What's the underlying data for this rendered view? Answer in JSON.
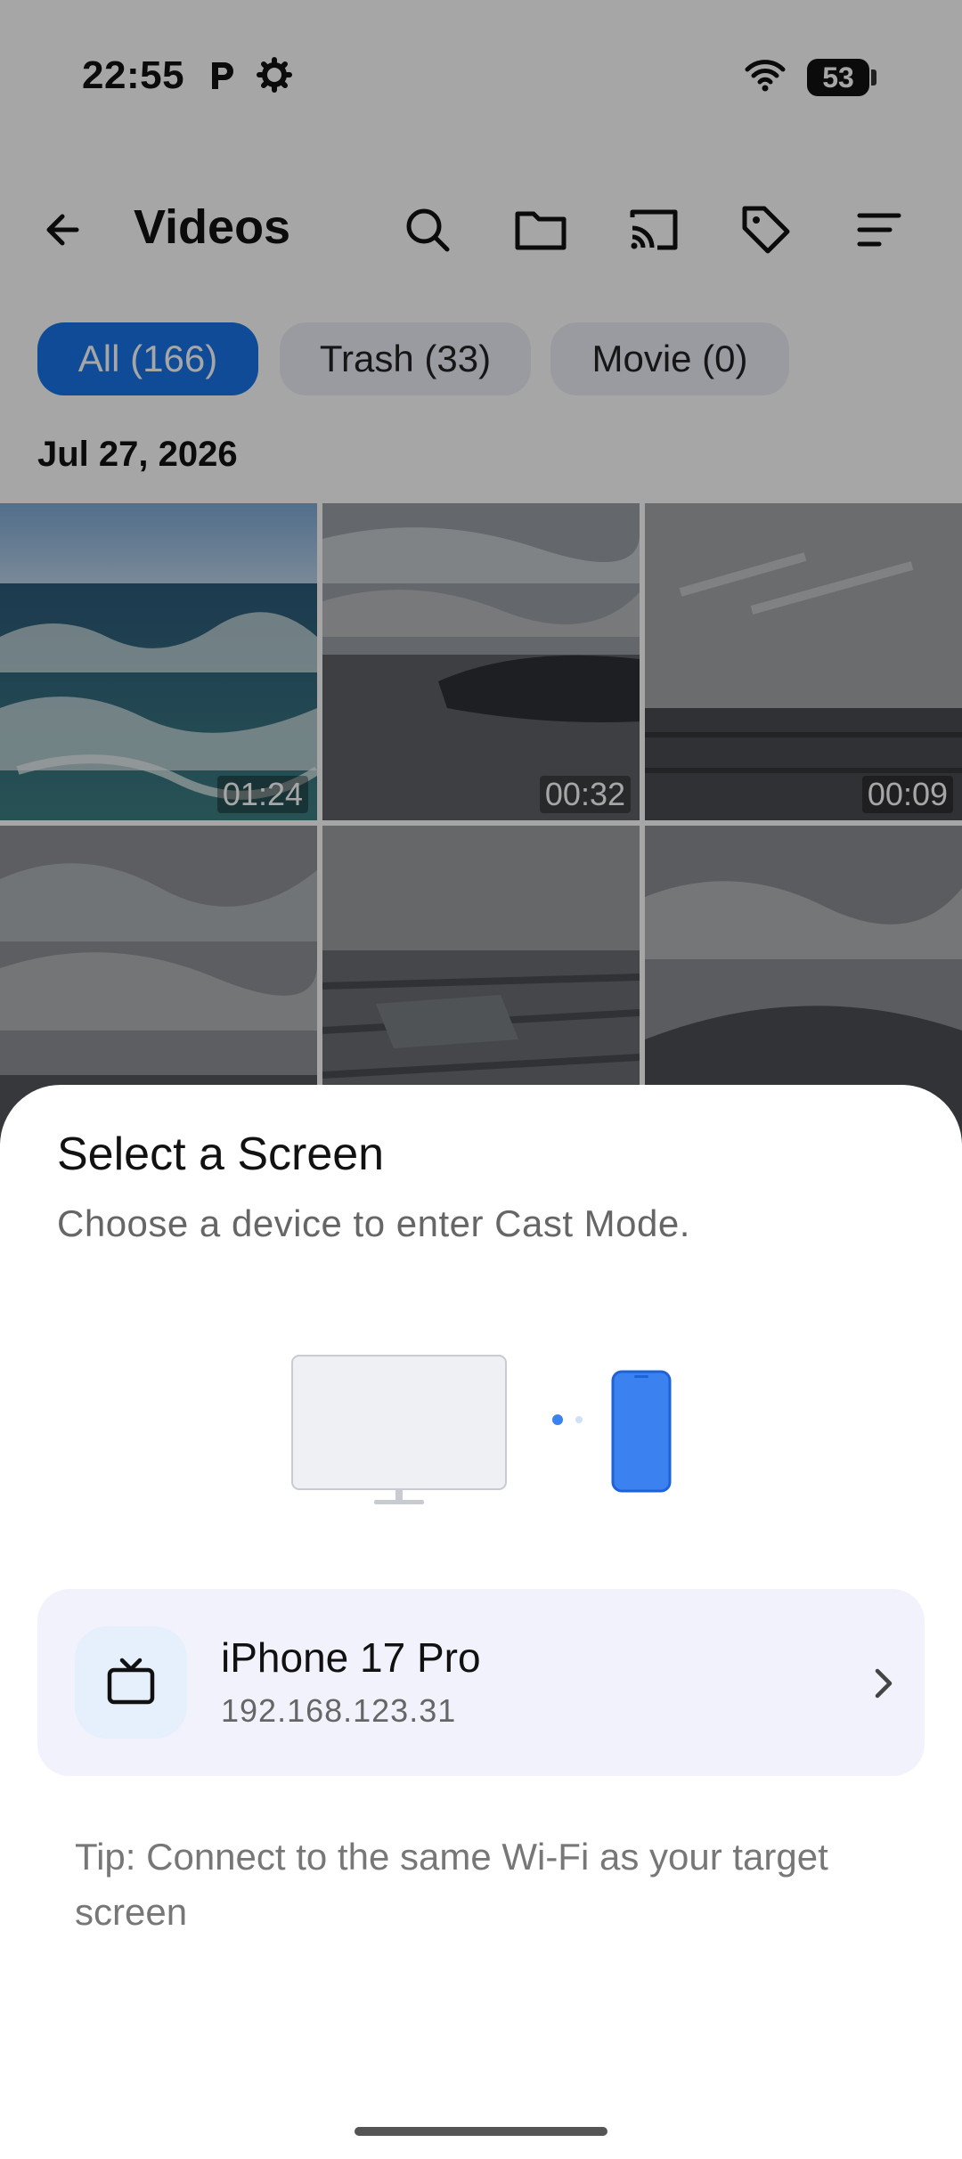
{
  "status_bar": {
    "time": "22:55",
    "icons": [
      "parking-icon",
      "settings-gear-icon",
      "wifi-icon"
    ],
    "battery_level": "53"
  },
  "toolbar": {
    "title": "Videos",
    "actions": [
      "back-arrow-icon",
      "search-icon",
      "folder-icon",
      "cast-icon",
      "tag-icon",
      "sort-icon"
    ]
  },
  "filters": [
    {
      "label": "All (166)",
      "active": true
    },
    {
      "label": "Trash (33)",
      "active": false
    },
    {
      "label": "Movie (0)",
      "active": false
    }
  ],
  "section_date": "Jul 27, 2026",
  "videos": [
    {
      "duration": "01:24"
    },
    {
      "duration": "00:32"
    },
    {
      "duration": "00:09"
    }
  ],
  "cast_sheet": {
    "title": "Select a Screen",
    "subtitle": "Choose a device to enter Cast Mode.",
    "devices": [
      {
        "name": "iPhone 17 Pro",
        "ip": "192.168.123.31",
        "icon": "tv-icon"
      }
    ],
    "tip": "Tip: Connect to the same Wi-Fi as your target screen"
  },
  "colors": {
    "accent": "#1a73e8",
    "phone_blue": "#3b82f0",
    "card_bg": "#f2f2fc"
  }
}
